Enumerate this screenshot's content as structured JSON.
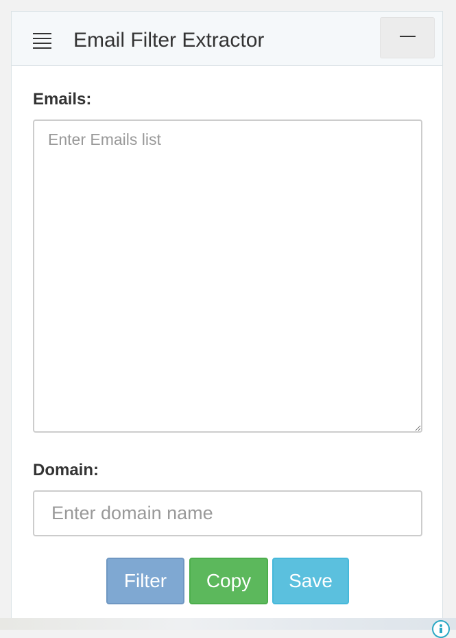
{
  "header": {
    "title": "Email Filter Extractor",
    "menu_icon": "hamburger-icon",
    "minimize_icon": "minimize-icon"
  },
  "emails": {
    "label": "Emails:",
    "placeholder": "Enter Emails list",
    "value": ""
  },
  "domain": {
    "label": "Domain:",
    "placeholder": "Enter domain name",
    "value": ""
  },
  "buttons": {
    "filter": "Filter",
    "copy": "Copy",
    "save": "Save"
  },
  "colors": {
    "filter": "#7fa8d2",
    "copy": "#5cb85c",
    "save": "#5bc0de",
    "info_icon": "#2aa8c4"
  },
  "footer": {
    "info_icon": "info-icon"
  }
}
